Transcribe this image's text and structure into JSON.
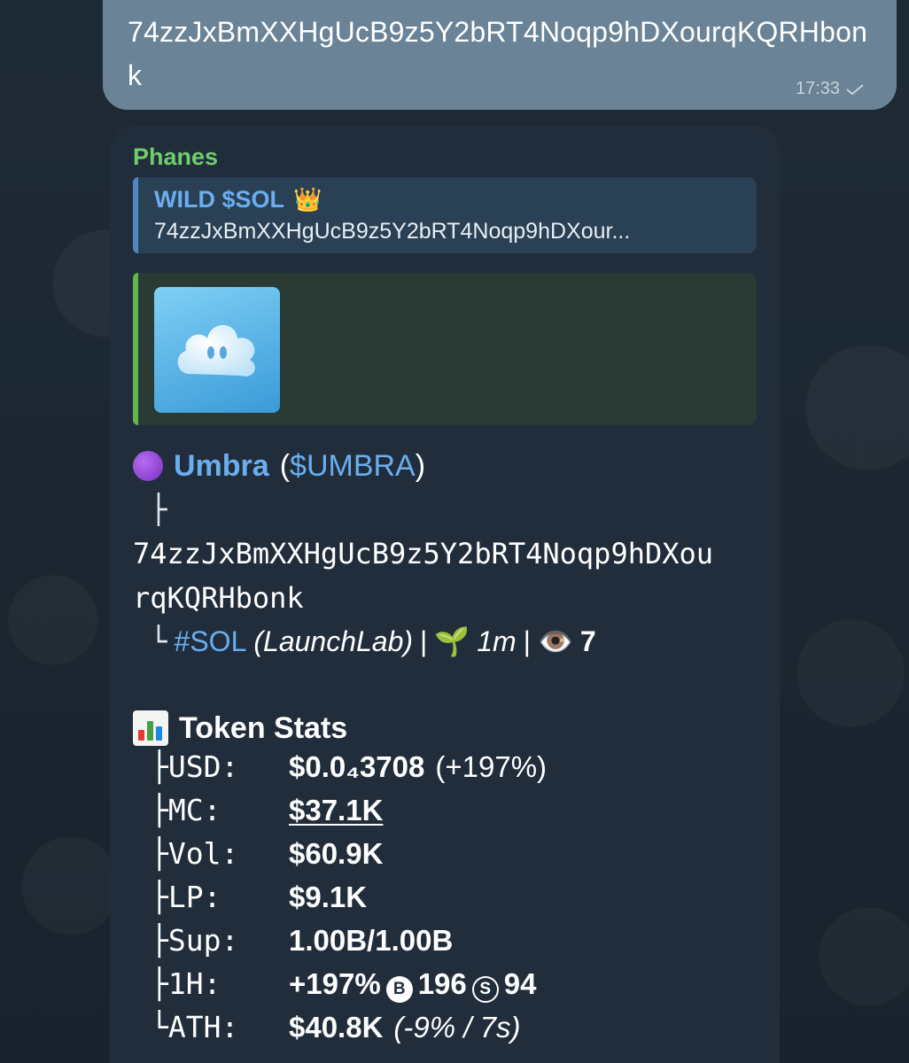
{
  "outgoing": {
    "text": "74zzJxBmXXHgUcB9z5Y2bRT4Noqp9hDXourqKQRHbonk",
    "time": "17:33"
  },
  "incoming": {
    "sender": "Phanes",
    "reply": {
      "title": "WILD $SOL",
      "title_emoji": "crown-icon",
      "subtitle": "74zzJxBmXXHgUcB9z5Y2bRT4Noqp9hDXour..."
    },
    "token": {
      "name": "Umbra",
      "ticker": "$UMBRA",
      "address_line1": "74zzJxBmXXHgUcB9z5Y2bRT4Noqp9hDXou",
      "address_line2": "rqKQRHbonk",
      "chain_tag": "#SOL",
      "launchpad": "(LaunchLab)",
      "age": "1m",
      "views": "7"
    },
    "stats": {
      "title": "Token Stats",
      "rows": [
        {
          "label": "USD:",
          "value": "$0.0₄3708",
          "extra": "(+197%)"
        },
        {
          "label": "MC:",
          "value": "$37.1K"
        },
        {
          "label": "Vol:",
          "value": "$60.9K"
        },
        {
          "label": "LP:",
          "value": "$9.1K"
        },
        {
          "label": "Sup:",
          "value": "1.00B/1.00B"
        },
        {
          "label": "1H:",
          "value": "+197%",
          "buys": "196",
          "sells": "94",
          "buy_glyph": "B",
          "sell_glyph": "S"
        },
        {
          "label": "ATH:",
          "value": "$40.8K",
          "extra": "(-9% / 7s)"
        }
      ]
    }
  },
  "colors": {
    "accent_link": "#6aaef0",
    "sender": "#6fcd6a",
    "outgoing_bubble": "#6a8396",
    "incoming_bubble": "#212d3b"
  }
}
